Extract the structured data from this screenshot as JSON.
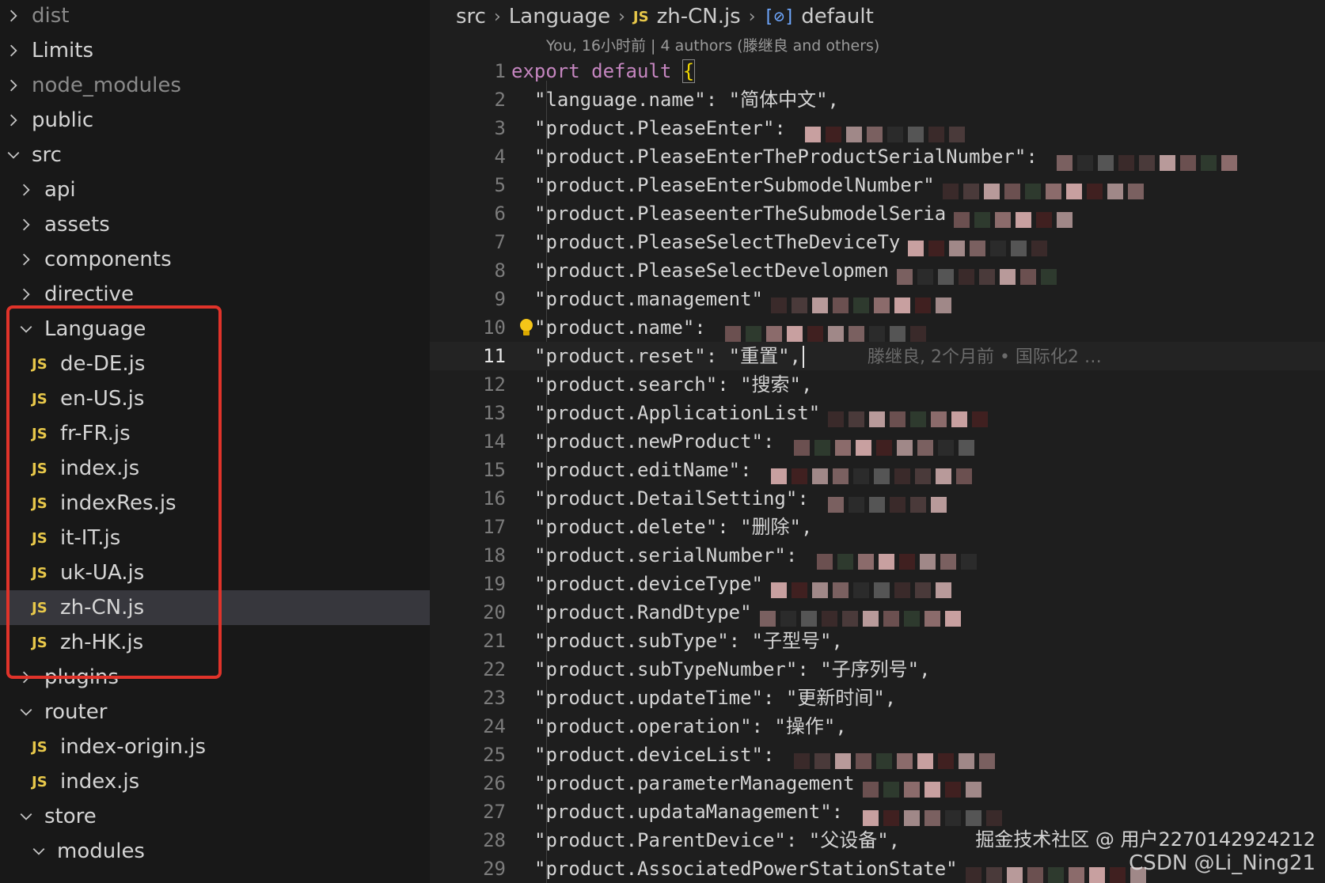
{
  "sidebar": {
    "items": [
      {
        "label": "dist",
        "type": "folder",
        "expanded": false,
        "depth": 0,
        "dim": true
      },
      {
        "label": "Limits",
        "type": "folder",
        "expanded": false,
        "depth": 0
      },
      {
        "label": "node_modules",
        "type": "folder",
        "expanded": false,
        "depth": 0,
        "dim": true
      },
      {
        "label": "public",
        "type": "folder",
        "expanded": false,
        "depth": 0
      },
      {
        "label": "src",
        "type": "folder",
        "expanded": true,
        "depth": 0
      },
      {
        "label": "api",
        "type": "folder",
        "expanded": false,
        "depth": 1
      },
      {
        "label": "assets",
        "type": "folder",
        "expanded": false,
        "depth": 1
      },
      {
        "label": "components",
        "type": "folder",
        "expanded": false,
        "depth": 1
      },
      {
        "label": "directive",
        "type": "folder",
        "expanded": false,
        "depth": 1
      },
      {
        "label": "Language",
        "type": "folder",
        "expanded": true,
        "depth": 1
      },
      {
        "label": "de-DE.js",
        "type": "file",
        "depth": 2
      },
      {
        "label": "en-US.js",
        "type": "file",
        "depth": 2
      },
      {
        "label": "fr-FR.js",
        "type": "file",
        "depth": 2
      },
      {
        "label": "index.js",
        "type": "file",
        "depth": 2
      },
      {
        "label": "indexRes.js",
        "type": "file",
        "depth": 2
      },
      {
        "label": "it-IT.js",
        "type": "file",
        "depth": 2
      },
      {
        "label": "uk-UA.js",
        "type": "file",
        "depth": 2
      },
      {
        "label": "zh-CN.js",
        "type": "file",
        "depth": 2,
        "selected": true
      },
      {
        "label": "zh-HK.js",
        "type": "file",
        "depth": 2
      },
      {
        "label": "plugins",
        "type": "folder",
        "expanded": false,
        "depth": 1
      },
      {
        "label": "router",
        "type": "folder",
        "expanded": true,
        "depth": 1
      },
      {
        "label": "index-origin.js",
        "type": "file",
        "depth": 2
      },
      {
        "label": "index.js",
        "type": "file",
        "depth": 2
      },
      {
        "label": "store",
        "type": "folder",
        "expanded": true,
        "depth": 1
      },
      {
        "label": "modules",
        "type": "folder",
        "expanded": true,
        "depth": 2
      }
    ],
    "file_badge": "JS"
  },
  "breadcrumb": {
    "items": [
      "src",
      "Language",
      "zh-CN.js",
      "default"
    ],
    "file_badge": "JS"
  },
  "blame": "You, 16小时前 | 4 authors (滕继良 and others)",
  "inline_blame": "滕继良, 2个月前 • 国际化2 …",
  "editor": {
    "current_line": 11,
    "lines": [
      {
        "n": "1",
        "text": "export default {",
        "kind": "header"
      },
      {
        "n": "2",
        "text": "\"language.name\": \"简体中文\","
      },
      {
        "n": "3",
        "text": "\"product.PleaseEnter\": ",
        "blurred": true
      },
      {
        "n": "4",
        "text": "\"product.PleaseEnterTheProductSerialNumber\": ",
        "blurred": true
      },
      {
        "n": "5",
        "text": "\"product.PleaseEnterSubmodelNumber\"",
        "blurred": true
      },
      {
        "n": "6",
        "text": "\"product.PleaseenterTheSubmodelSeria",
        "blurred": true
      },
      {
        "n": "7",
        "text": "\"product.PleaseSelectTheDeviceTy",
        "blurred": true
      },
      {
        "n": "8",
        "text": "\"product.PleaseSelectDevelopmen",
        "blurred": true
      },
      {
        "n": "9",
        "text": "\"product.management\"",
        "blurred": true
      },
      {
        "n": "10",
        "text": "\"product.name\": ",
        "blurred": true,
        "bulb": true
      },
      {
        "n": "11",
        "text": "\"product.reset\": \"重置\","
      },
      {
        "n": "12",
        "text": "\"product.search\": \"搜索\","
      },
      {
        "n": "13",
        "text": "\"product.ApplicationList\"",
        "blurred": true
      },
      {
        "n": "14",
        "text": "\"product.newProduct\": ",
        "blurred": true
      },
      {
        "n": "15",
        "text": "\"product.editName\": ",
        "blurred": true
      },
      {
        "n": "16",
        "text": "\"product.DetailSetting\": ",
        "blurred": true
      },
      {
        "n": "17",
        "text": "\"product.delete\": \"删除\","
      },
      {
        "n": "18",
        "text": "\"product.serialNumber\": ",
        "blurred": true
      },
      {
        "n": "19",
        "text": "\"product.deviceType\"",
        "blurred": true
      },
      {
        "n": "20",
        "text": "\"product.RandDtype\"",
        "blurred": true
      },
      {
        "n": "21",
        "text": "\"product.subType\": \"子型号\","
      },
      {
        "n": "22",
        "text": "\"product.subTypeNumber\": \"子序列号\","
      },
      {
        "n": "23",
        "text": "\"product.updateTime\": \"更新时间\","
      },
      {
        "n": "24",
        "text": "\"product.operation\": \"操作\","
      },
      {
        "n": "25",
        "text": "\"product.deviceList\": ",
        "blurred": true
      },
      {
        "n": "26",
        "text": "\"product.parameterManagement",
        "blurred": true
      },
      {
        "n": "27",
        "text": "\"product.updataManagement\": ",
        "blurred": true
      },
      {
        "n": "28",
        "text": "\"product.ParentDevice\": \"父设备\","
      },
      {
        "n": "29",
        "text": "\"product.AssociatedPowerStationState\"",
        "blurred": true
      }
    ]
  },
  "watermark": {
    "line1": "掘金技术社区 @ 用户2270142924212",
    "line2": "CSDN @Li_Ning21"
  },
  "colors": {
    "highlight_border": "#e0332a",
    "js_badge": "#e8c84a",
    "keyword": "#c586c0"
  }
}
